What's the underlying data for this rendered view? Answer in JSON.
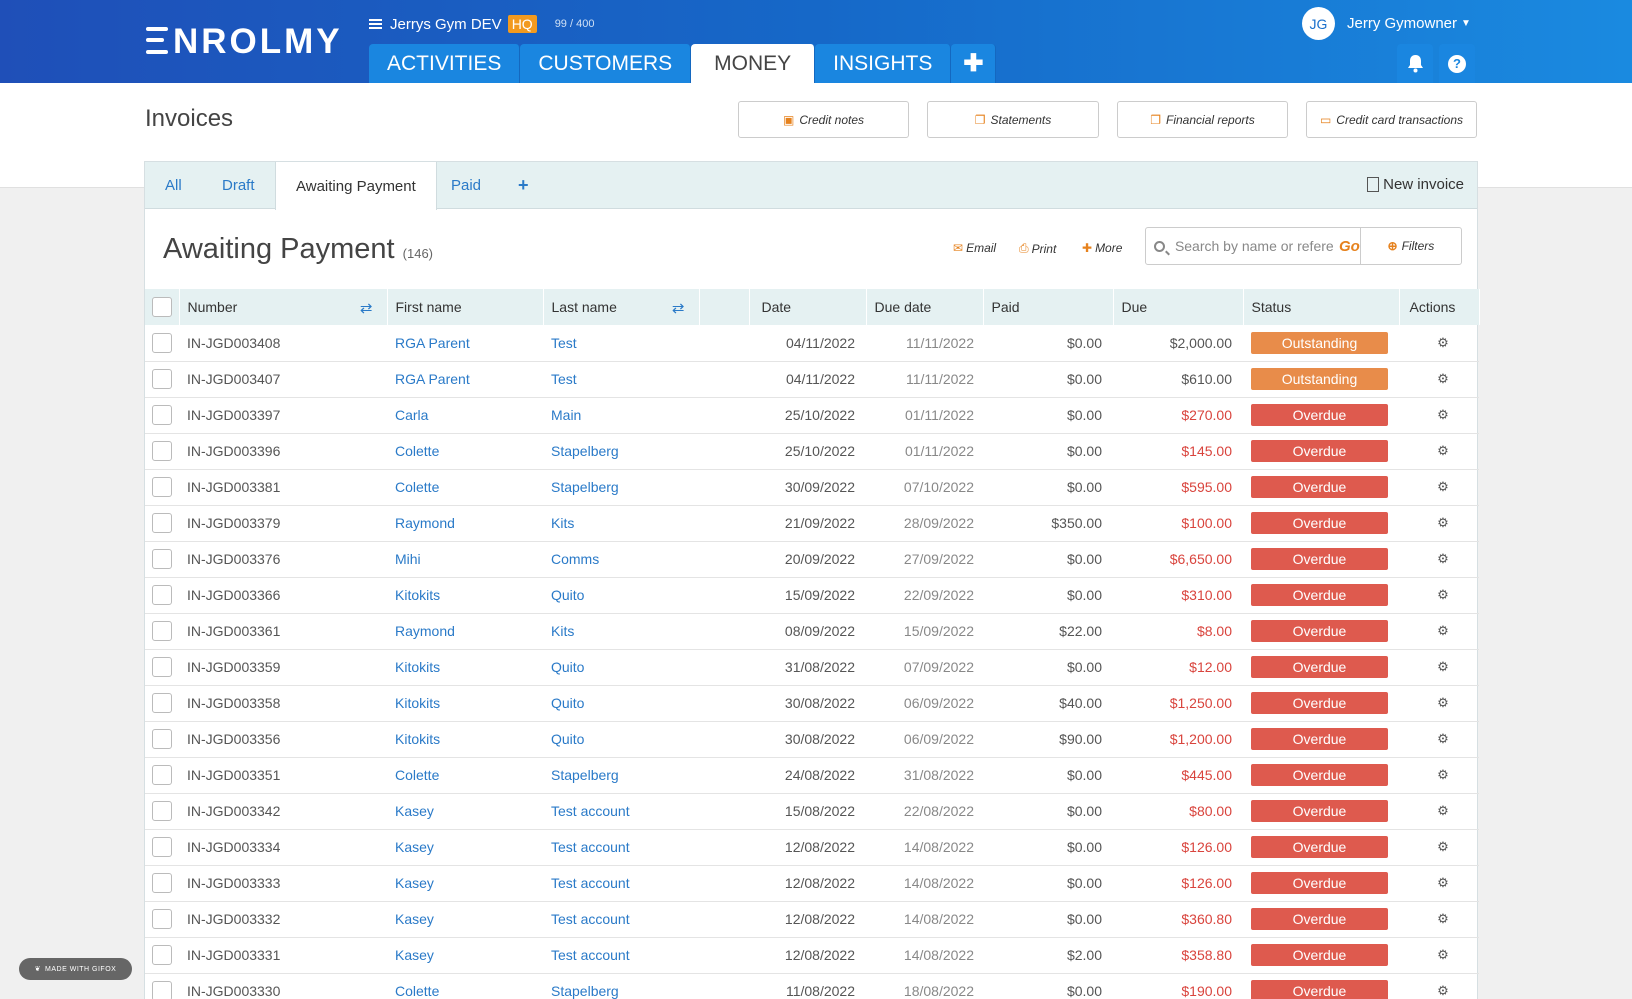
{
  "app": {
    "logo": "NROLMY",
    "org_name": "Jerrys Gym DEV",
    "org_badge": "HQ",
    "org_count": "99 / 400"
  },
  "nav": {
    "tabs": [
      {
        "label": "ACTIVITIES"
      },
      {
        "label": "CUSTOMERS"
      },
      {
        "label": "MONEY"
      },
      {
        "label": "INSIGHTS"
      }
    ],
    "plus": "✚"
  },
  "user": {
    "initials": "JG",
    "name": "Jerry Gymowner"
  },
  "header_icons": {
    "bell": "bell-icon",
    "help": "?"
  },
  "page": {
    "title": "Invoices"
  },
  "sub_buttons": {
    "credit_notes": "Credit notes",
    "statements": "Statements",
    "financial_reports": "Financial reports",
    "cc_transactions": "Credit card transactions"
  },
  "filter_tabs": {
    "all": "All",
    "draft": "Draft",
    "awaiting": "Awaiting Payment",
    "paid": "Paid",
    "plus": "+",
    "new_invoice": "New invoice"
  },
  "section": {
    "title": "Awaiting Payment",
    "count": "(146)"
  },
  "actions": {
    "email": "Email",
    "print": "Print",
    "more": "More"
  },
  "search": {
    "placeholder": "Search by name or reference",
    "go": "Go",
    "filters": "Filters"
  },
  "table": {
    "headers": {
      "number": "Number",
      "first_name": "First name",
      "last_name": "Last name",
      "date": "Date",
      "due_date": "Due date",
      "paid": "Paid",
      "due": "Due",
      "status": "Status",
      "actions": "Actions"
    },
    "rows": [
      {
        "number": "IN-JGD003408",
        "first": "RGA Parent",
        "last": "Test",
        "date": "04/11/2022",
        "due_date": "11/11/2022",
        "paid": "$0.00",
        "due": "$2,000.00",
        "status": "Outstanding"
      },
      {
        "number": "IN-JGD003407",
        "first": "RGA Parent",
        "last": "Test",
        "date": "04/11/2022",
        "due_date": "11/11/2022",
        "paid": "$0.00",
        "due": "$610.00",
        "status": "Outstanding"
      },
      {
        "number": "IN-JGD003397",
        "first": "Carla",
        "last": "Main",
        "date": "25/10/2022",
        "due_date": "01/11/2022",
        "paid": "$0.00",
        "due": "$270.00",
        "status": "Overdue"
      },
      {
        "number": "IN-JGD003396",
        "first": "Colette",
        "last": "Stapelberg",
        "date": "25/10/2022",
        "due_date": "01/11/2022",
        "paid": "$0.00",
        "due": "$145.00",
        "status": "Overdue"
      },
      {
        "number": "IN-JGD003381",
        "first": "Colette",
        "last": "Stapelberg",
        "date": "30/09/2022",
        "due_date": "07/10/2022",
        "paid": "$0.00",
        "due": "$595.00",
        "status": "Overdue"
      },
      {
        "number": "IN-JGD003379",
        "first": "Raymond",
        "last": "Kits",
        "date": "21/09/2022",
        "due_date": "28/09/2022",
        "paid": "$350.00",
        "due": "$100.00",
        "status": "Overdue"
      },
      {
        "number": "IN-JGD003376",
        "first": "Mihi",
        "last": "Comms",
        "date": "20/09/2022",
        "due_date": "27/09/2022",
        "paid": "$0.00",
        "due": "$6,650.00",
        "status": "Overdue"
      },
      {
        "number": "IN-JGD003366",
        "first": "Kitokits",
        "last": "Quito",
        "date": "15/09/2022",
        "due_date": "22/09/2022",
        "paid": "$0.00",
        "due": "$310.00",
        "status": "Overdue"
      },
      {
        "number": "IN-JGD003361",
        "first": "Raymond",
        "last": "Kits",
        "date": "08/09/2022",
        "due_date": "15/09/2022",
        "paid": "$22.00",
        "due": "$8.00",
        "status": "Overdue"
      },
      {
        "number": "IN-JGD003359",
        "first": "Kitokits",
        "last": "Quito",
        "date": "31/08/2022",
        "due_date": "07/09/2022",
        "paid": "$0.00",
        "due": "$12.00",
        "status": "Overdue"
      },
      {
        "number": "IN-JGD003358",
        "first": "Kitokits",
        "last": "Quito",
        "date": "30/08/2022",
        "due_date": "06/09/2022",
        "paid": "$40.00",
        "due": "$1,250.00",
        "status": "Overdue"
      },
      {
        "number": "IN-JGD003356",
        "first": "Kitokits",
        "last": "Quito",
        "date": "30/08/2022",
        "due_date": "06/09/2022",
        "paid": "$90.00",
        "due": "$1,200.00",
        "status": "Overdue"
      },
      {
        "number": "IN-JGD003351",
        "first": "Colette",
        "last": "Stapelberg",
        "date": "24/08/2022",
        "due_date": "31/08/2022",
        "paid": "$0.00",
        "due": "$445.00",
        "status": "Overdue"
      },
      {
        "number": "IN-JGD003342",
        "first": "Kasey",
        "last": "Test account",
        "date": "15/08/2022",
        "due_date": "22/08/2022",
        "paid": "$0.00",
        "due": "$80.00",
        "status": "Overdue"
      },
      {
        "number": "IN-JGD003334",
        "first": "Kasey",
        "last": "Test account",
        "date": "12/08/2022",
        "due_date": "14/08/2022",
        "paid": "$0.00",
        "due": "$126.00",
        "status": "Overdue"
      },
      {
        "number": "IN-JGD003333",
        "first": "Kasey",
        "last": "Test account",
        "date": "12/08/2022",
        "due_date": "14/08/2022",
        "paid": "$0.00",
        "due": "$126.00",
        "status": "Overdue"
      },
      {
        "number": "IN-JGD003332",
        "first": "Kasey",
        "last": "Test account",
        "date": "12/08/2022",
        "due_date": "14/08/2022",
        "paid": "$0.00",
        "due": "$360.80",
        "status": "Overdue"
      },
      {
        "number": "IN-JGD003331",
        "first": "Kasey",
        "last": "Test account",
        "date": "12/08/2022",
        "due_date": "14/08/2022",
        "paid": "$2.00",
        "due": "$358.80",
        "status": "Overdue"
      },
      {
        "number": "IN-JGD003330",
        "first": "Colette",
        "last": "Stapelberg",
        "date": "11/08/2022",
        "due_date": "18/08/2022",
        "paid": "$0.00",
        "due": "$190.00",
        "status": "Overdue"
      }
    ]
  },
  "watermark": "MADE WITH GIFOX",
  "colors": {
    "header_start": "#1f4fb8",
    "header_end": "#1a8ae0",
    "accent_orange": "#e6821e",
    "link_blue": "#2a7ac8",
    "overdue": "#de5a4e",
    "outstanding": "#e88c4a"
  }
}
